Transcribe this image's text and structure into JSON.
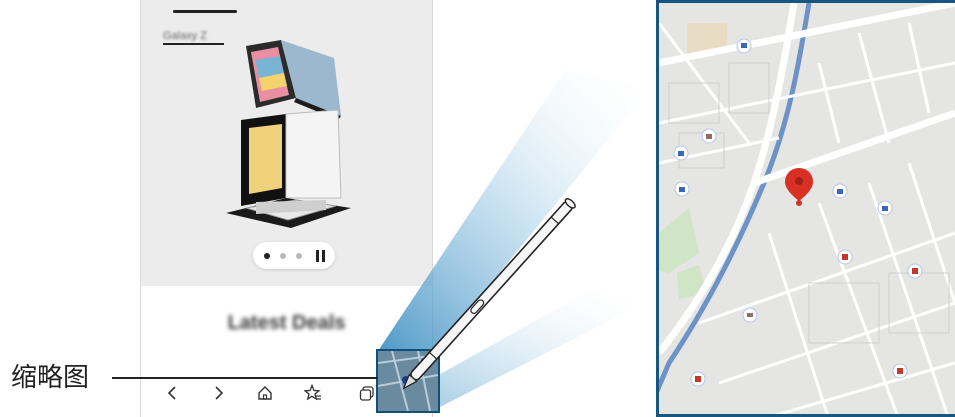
{
  "callout": {
    "label": "缩略图"
  },
  "browser": {
    "hero": {
      "blurred_label": "Galaxy Z",
      "carousel_dots": 3,
      "active_dot_index": 0
    },
    "deals_title": "Latest Deals",
    "navbar": {
      "back": "chevron-left-icon",
      "forward": "chevron-right-icon",
      "home": "home-icon",
      "bookmarks": "star-icon",
      "tabs": "tabs-icon"
    }
  },
  "colors": {
    "frame_blue": "#17577f",
    "beam_blue": "#3f93c4",
    "map_road": "#ffffff",
    "map_bg": "#e5e5e3",
    "pin_red": "#d93025",
    "marker_red": "#c0392b",
    "poi_blue": "#3a67b6"
  }
}
